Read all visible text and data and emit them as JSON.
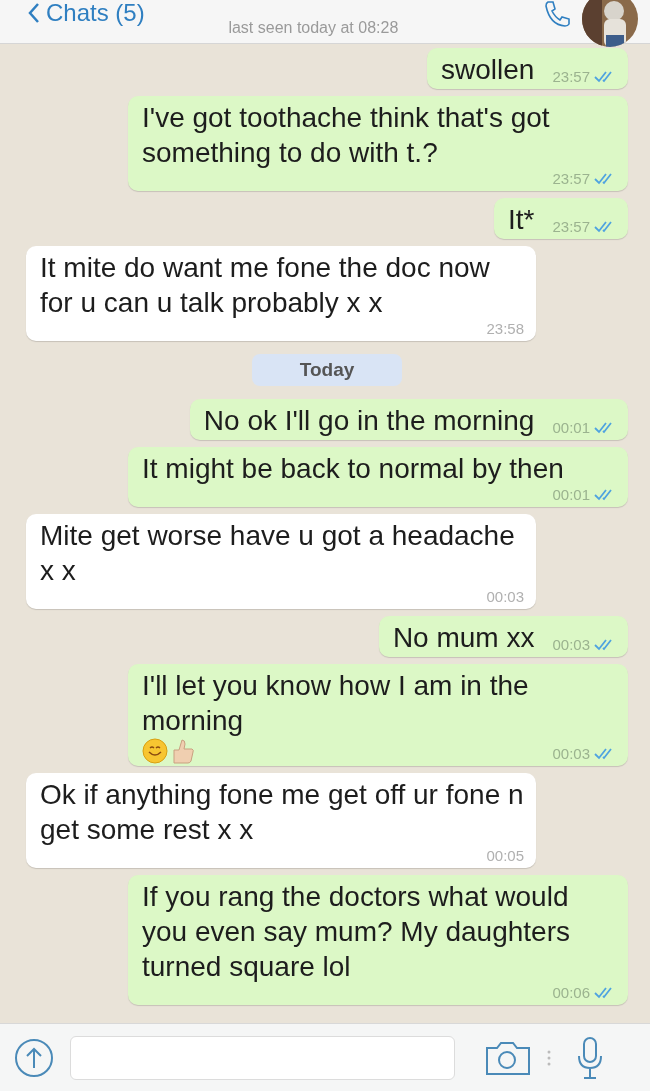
{
  "header": {
    "back_label": "Chats (5)",
    "status": "last seen today at 08:28"
  },
  "messages": [
    {
      "kind": "text",
      "sent": true,
      "text": "swollen",
      "time": "23:57",
      "read": true
    },
    {
      "kind": "text",
      "sent": true,
      "text": "I've got toothache think that's got something to do with t.?",
      "time": "23:57",
      "read": true
    },
    {
      "kind": "text",
      "sent": true,
      "text": "It*",
      "time": "23:57",
      "read": true
    },
    {
      "kind": "text",
      "sent": false,
      "text": "It mite do want me fone the doc now for u can u talk probably x x",
      "time": "23:58"
    },
    {
      "kind": "date",
      "text": "Today"
    },
    {
      "kind": "text",
      "sent": true,
      "text": "No ok I'll go in the morning",
      "time": "00:01",
      "read": true
    },
    {
      "kind": "text",
      "sent": true,
      "text": "It might be back to normal by then",
      "time": "00:01",
      "read": true
    },
    {
      "kind": "text",
      "sent": false,
      "text": "Mite get worse have u got a headache x x",
      "time": "00:03"
    },
    {
      "kind": "text",
      "sent": true,
      "text": "No mum xx",
      "time": "00:03",
      "read": true
    },
    {
      "kind": "emoji-text",
      "sent": true,
      "text": "I'll let you know how I am in the morning",
      "time": "00:03",
      "read": true
    },
    {
      "kind": "text",
      "sent": false,
      "text": "Ok if anything fone me get off ur fone n get some rest x x",
      "time": "00:05"
    },
    {
      "kind": "text",
      "sent": true,
      "text": "If you rang the doctors what would you even say mum? My daughters turned square lol",
      "time": "00:06",
      "read": true
    }
  ]
}
